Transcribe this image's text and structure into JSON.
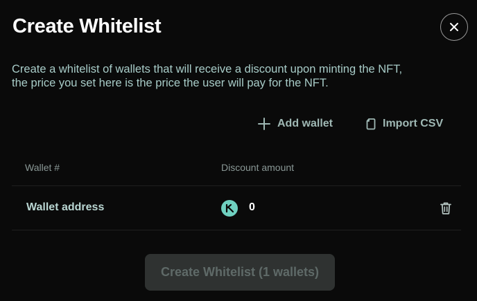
{
  "modal": {
    "title": "Create Whitelist",
    "description_line1": "Create a whitelist of wallets that will receive a discount upon minting the NFT,",
    "description_line2": "the price you set here is the price the user will pay for the NFT."
  },
  "actions": {
    "add_wallet": "Add wallet",
    "import_csv": "Import CSV"
  },
  "table": {
    "columns": [
      "Wallet #",
      "Discount amount"
    ],
    "rows": [
      {
        "wallet": "Wallet address",
        "token_icon": "token-icon",
        "discount": "0"
      }
    ]
  },
  "submit": {
    "label": "Create Whitelist (1 wallets)",
    "disabled": true
  },
  "icons": {
    "close": "close-icon",
    "add": "plus-icon",
    "import": "file-icon",
    "delete": "trash-icon"
  },
  "colors": {
    "background": "#0a0a0a",
    "accent": "#6fd0c0",
    "muted_text": "#a8ccc8",
    "disabled_button": "#2f3231"
  }
}
